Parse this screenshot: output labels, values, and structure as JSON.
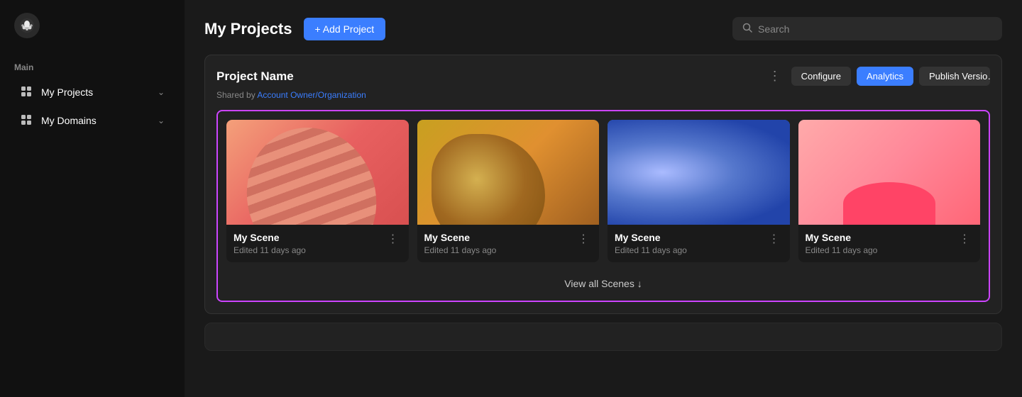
{
  "app": {
    "logo_char": "🐙"
  },
  "sidebar": {
    "section_label": "Main",
    "items": [
      {
        "id": "my-projects",
        "label": "My Projects",
        "has_chevron": true
      },
      {
        "id": "my-domains",
        "label": "My Domains",
        "has_chevron": true
      }
    ]
  },
  "header": {
    "title": "My Projects",
    "add_button_label": "+ Add Project",
    "search_placeholder": "Search"
  },
  "project": {
    "name": "Project Name",
    "shared_by_prefix": "Shared by ",
    "shared_by_link": "Account Owner/Organization",
    "actions": [
      {
        "id": "configure",
        "label": "Configure"
      },
      {
        "id": "analytics",
        "label": "Analytics"
      },
      {
        "id": "publish",
        "label": "Publish Version"
      }
    ],
    "scenes": [
      {
        "id": 1,
        "name": "My Scene",
        "edited": "Edited 11 days ago",
        "thumb_class": "scene-thumb-1"
      },
      {
        "id": 2,
        "name": "My Scene",
        "edited": "Edited 11 days ago",
        "thumb_class": "scene-thumb-2"
      },
      {
        "id": 3,
        "name": "My Scene",
        "edited": "Edited 11 days ago",
        "thumb_class": "scene-thumb-3"
      },
      {
        "id": 4,
        "name": "My Scene",
        "edited": "Edited 11 days ago",
        "thumb_class": "scene-thumb-4"
      }
    ],
    "view_all_label": "View all Scenes ↓"
  },
  "colors": {
    "accent_blue": "#3b7eff",
    "accent_purple": "#cc44ff",
    "sidebar_bg": "#111111",
    "main_bg": "#1a1a1a",
    "card_bg": "#222222"
  }
}
